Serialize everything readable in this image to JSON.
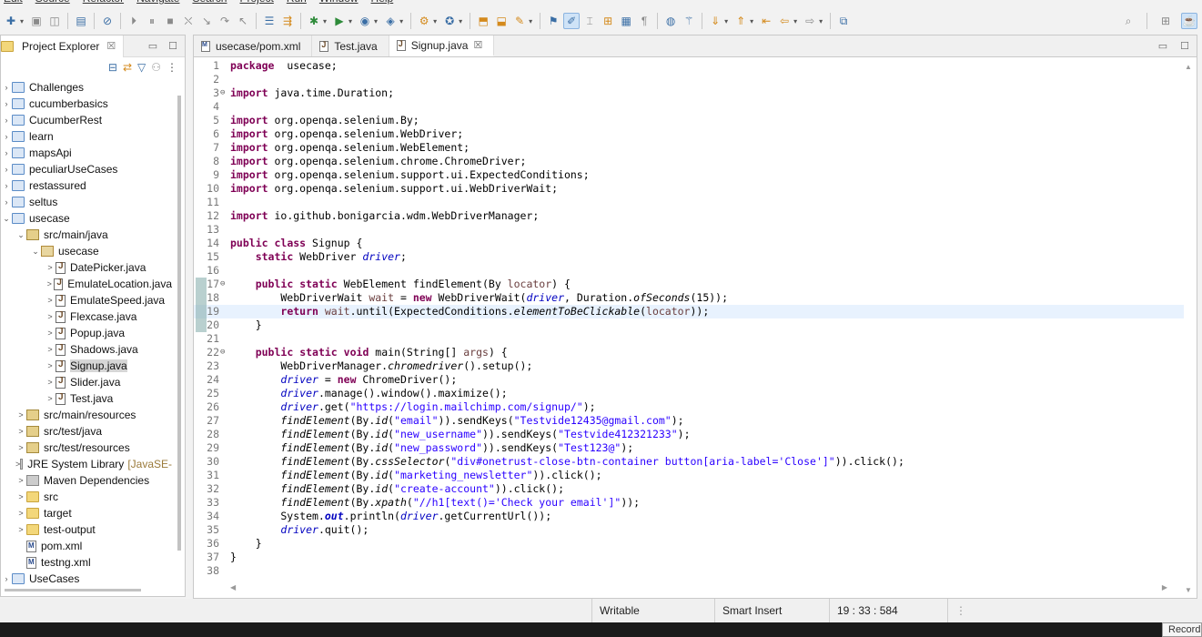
{
  "menu": [
    "Edit",
    "Source",
    "Refactor",
    "Navigate",
    "Search",
    "Project",
    "Run",
    "Window",
    "Help"
  ],
  "explorer": {
    "title": "Project Explorer",
    "close": "☒",
    "tree": [
      {
        "label": "Challenges",
        "depth": 0,
        "twisty": "›",
        "icon": "project"
      },
      {
        "label": "cucumberbasics",
        "depth": 0,
        "twisty": "›",
        "icon": "project"
      },
      {
        "label": "CucumberRest",
        "depth": 0,
        "twisty": "›",
        "icon": "project"
      },
      {
        "label": "learn",
        "depth": 0,
        "twisty": "›",
        "icon": "maven-project"
      },
      {
        "label": "mapsApi",
        "depth": 0,
        "twisty": "›",
        "icon": "project"
      },
      {
        "label": "peculiarUseCases",
        "depth": 0,
        "twisty": "›",
        "icon": "project"
      },
      {
        "label": "restassured",
        "depth": 0,
        "twisty": "›",
        "icon": "project"
      },
      {
        "label": "seltus",
        "depth": 0,
        "twisty": "›",
        "icon": "project"
      },
      {
        "label": "usecase",
        "depth": 0,
        "twisty": "⌄",
        "icon": "maven-project"
      },
      {
        "label": "src/main/java",
        "depth": 1,
        "twisty": "⌄",
        "icon": "src-folder"
      },
      {
        "label": "usecase",
        "depth": 2,
        "twisty": "⌄",
        "icon": "package"
      },
      {
        "label": "DatePicker.java",
        "depth": 3,
        "twisty": ">",
        "icon": "java"
      },
      {
        "label": "EmulateLocation.java",
        "depth": 3,
        "twisty": ">",
        "icon": "java"
      },
      {
        "label": "EmulateSpeed.java",
        "depth": 3,
        "twisty": ">",
        "icon": "java"
      },
      {
        "label": "Flexcase.java",
        "depth": 3,
        "twisty": ">",
        "icon": "java"
      },
      {
        "label": "Popup.java",
        "depth": 3,
        "twisty": ">",
        "icon": "java"
      },
      {
        "label": "Shadows.java",
        "depth": 3,
        "twisty": ">",
        "icon": "java"
      },
      {
        "label": "Signup.java",
        "depth": 3,
        "twisty": ">",
        "icon": "java",
        "selected": true
      },
      {
        "label": "Slider.java",
        "depth": 3,
        "twisty": ">",
        "icon": "java"
      },
      {
        "label": "Test.java",
        "depth": 3,
        "twisty": ">",
        "icon": "java"
      },
      {
        "label": "src/main/resources",
        "depth": 1,
        "twisty": ">",
        "icon": "src-folder"
      },
      {
        "label": "src/test/java",
        "depth": 1,
        "twisty": ">",
        "icon": "src-folder"
      },
      {
        "label": "src/test/resources",
        "depth": 1,
        "twisty": ">",
        "icon": "src-folder"
      },
      {
        "label": "JRE System Library",
        "decoration": "[JavaSE-",
        "depth": 1,
        "twisty": ">",
        "icon": "library"
      },
      {
        "label": "Maven Dependencies",
        "depth": 1,
        "twisty": ">",
        "icon": "library"
      },
      {
        "label": "src",
        "depth": 1,
        "twisty": ">",
        "icon": "folder"
      },
      {
        "label": "target",
        "depth": 1,
        "twisty": ">",
        "icon": "folder"
      },
      {
        "label": "test-output",
        "depth": 1,
        "twisty": ">",
        "icon": "folder"
      },
      {
        "label": "pom.xml",
        "depth": 1,
        "twisty": "",
        "icon": "xml"
      },
      {
        "label": "testng.xml",
        "depth": 1,
        "twisty": "",
        "icon": "xml"
      },
      {
        "label": "UseCases",
        "depth": 0,
        "twisty": "›",
        "icon": "project"
      }
    ]
  },
  "editor": {
    "tabs": [
      {
        "label": "usecase/pom.xml",
        "type": "m",
        "active": false
      },
      {
        "label": "Test.java",
        "type": "j",
        "active": false
      },
      {
        "label": "Signup.java",
        "type": "j",
        "active": true,
        "close": "☒"
      }
    ],
    "current_line": 19,
    "changed_lines": [
      17,
      18,
      19,
      20
    ],
    "fold_lines": [
      3,
      17,
      22
    ],
    "lines": [
      [
        [
          "kw",
          "package"
        ],
        [
          "",
          "  usecase;"
        ]
      ],
      [],
      [
        [
          "kw",
          "import"
        ],
        [
          "",
          " java.time.Duration;"
        ]
      ],
      [],
      [
        [
          "kw",
          "import"
        ],
        [
          "",
          " org.openqa.selenium.By;"
        ]
      ],
      [
        [
          "kw",
          "import"
        ],
        [
          "",
          " org.openqa.selenium.WebDriver;"
        ]
      ],
      [
        [
          "kw",
          "import"
        ],
        [
          "",
          " org.openqa.selenium.WebElement;"
        ]
      ],
      [
        [
          "kw",
          "import"
        ],
        [
          "",
          " org.openqa.selenium.chrome.ChromeDriver;"
        ]
      ],
      [
        [
          "kw",
          "import"
        ],
        [
          "",
          " org.openqa.selenium.support.ui.ExpectedConditions;"
        ]
      ],
      [
        [
          "kw",
          "import"
        ],
        [
          "",
          " org.openqa.selenium.support.ui.WebDriverWait;"
        ]
      ],
      [],
      [
        [
          "kw",
          "import"
        ],
        [
          "",
          " io.github.bonigarcia.wdm.WebDriverManager;"
        ]
      ],
      [],
      [
        [
          "kw",
          "public"
        ],
        [
          "",
          " "
        ],
        [
          "kw",
          "class"
        ],
        [
          "",
          " Signup {"
        ]
      ],
      [
        [
          "",
          "    "
        ],
        [
          "kw",
          "static"
        ],
        [
          "",
          " WebDriver "
        ],
        [
          "fld",
          "driver"
        ],
        [
          "",
          ";"
        ]
      ],
      [],
      [
        [
          "",
          "    "
        ],
        [
          "kw",
          "public"
        ],
        [
          "",
          " "
        ],
        [
          "kw",
          "static"
        ],
        [
          "",
          " WebElement findElement(By "
        ],
        [
          "param",
          "locator"
        ],
        [
          "",
          ") {"
        ]
      ],
      [
        [
          "",
          "        WebDriverWait "
        ],
        [
          "lvar",
          "wait"
        ],
        [
          "",
          " = "
        ],
        [
          "kw",
          "new"
        ],
        [
          "",
          " WebDriverWait("
        ],
        [
          "fld",
          "driver"
        ],
        [
          "",
          ", Duration."
        ],
        [
          "smeth",
          "ofSeconds"
        ],
        [
          "",
          "(15));"
        ]
      ],
      [
        [
          "",
          "        "
        ],
        [
          "kw",
          "return"
        ],
        [
          "",
          " "
        ],
        [
          "lvar",
          "wait"
        ],
        [
          "",
          ".until(ExpectedConditions."
        ],
        [
          "smeth",
          "elementToBeClickable"
        ],
        [
          "",
          "("
        ],
        [
          "param",
          "locator"
        ],
        [
          "",
          "));"
        ]
      ],
      [
        [
          "",
          "    }"
        ]
      ],
      [],
      [
        [
          "",
          "    "
        ],
        [
          "kw",
          "public"
        ],
        [
          "",
          " "
        ],
        [
          "kw",
          "static"
        ],
        [
          "",
          " "
        ],
        [
          "kw",
          "void"
        ],
        [
          "",
          " main(String[] "
        ],
        [
          "param",
          "args"
        ],
        [
          "",
          ") {"
        ]
      ],
      [
        [
          "",
          "        WebDriverManager."
        ],
        [
          "smeth",
          "chromedriver"
        ],
        [
          "",
          "().setup();"
        ]
      ],
      [
        [
          "",
          "        "
        ],
        [
          "fld",
          "driver"
        ],
        [
          "",
          " = "
        ],
        [
          "kw",
          "new"
        ],
        [
          "",
          " ChromeDriver();"
        ]
      ],
      [
        [
          "",
          "        "
        ],
        [
          "fld",
          "driver"
        ],
        [
          "",
          ".manage().window().maximize();"
        ]
      ],
      [
        [
          "",
          "        "
        ],
        [
          "fld",
          "driver"
        ],
        [
          "",
          ".get("
        ],
        [
          "str",
          "\"https://login.mailchimp.com/signup/\""
        ],
        [
          "",
          ");"
        ]
      ],
      [
        [
          "",
          "        "
        ],
        [
          "smeth",
          "findElement"
        ],
        [
          "",
          "(By."
        ],
        [
          "smeth",
          "id"
        ],
        [
          "",
          "("
        ],
        [
          "str",
          "\"email\""
        ],
        [
          "",
          "))."
        ],
        [
          "",
          "sendKeys("
        ],
        [
          "str",
          "\"Testvide12435@gmail.com\""
        ],
        [
          "",
          ");"
        ]
      ],
      [
        [
          "",
          "        "
        ],
        [
          "smeth",
          "findElement"
        ],
        [
          "",
          "(By."
        ],
        [
          "smeth",
          "id"
        ],
        [
          "",
          "("
        ],
        [
          "str",
          "\"new_username\""
        ],
        [
          "",
          "))."
        ],
        [
          "",
          "sendKeys("
        ],
        [
          "str",
          "\"Testvide412321233\""
        ],
        [
          "",
          ");"
        ]
      ],
      [
        [
          "",
          "        "
        ],
        [
          "smeth",
          "findElement"
        ],
        [
          "",
          "(By."
        ],
        [
          "smeth",
          "id"
        ],
        [
          "",
          "("
        ],
        [
          "str",
          "\"new_password\""
        ],
        [
          "",
          "))."
        ],
        [
          "",
          "sendKeys("
        ],
        [
          "str",
          "\"Test123@\""
        ],
        [
          "",
          ");"
        ]
      ],
      [
        [
          "",
          "        "
        ],
        [
          "smeth",
          "findElement"
        ],
        [
          "",
          "(By."
        ],
        [
          "smeth",
          "cssSelector"
        ],
        [
          "",
          "("
        ],
        [
          "str",
          "\"div#onetrust-close-btn-container button[aria-label='Close']\""
        ],
        [
          "",
          ")).click();"
        ]
      ],
      [
        [
          "",
          "        "
        ],
        [
          "smeth",
          "findElement"
        ],
        [
          "",
          "(By."
        ],
        [
          "smeth",
          "id"
        ],
        [
          "",
          "("
        ],
        [
          "str",
          "\"marketing_newsletter\""
        ],
        [
          "",
          ")).click();"
        ]
      ],
      [
        [
          "",
          "        "
        ],
        [
          "smeth",
          "findElement"
        ],
        [
          "",
          "(By."
        ],
        [
          "smeth",
          "id"
        ],
        [
          "",
          "("
        ],
        [
          "str",
          "\"create-account\""
        ],
        [
          "",
          ")).click();"
        ]
      ],
      [
        [
          "",
          "        "
        ],
        [
          "smeth",
          "findElement"
        ],
        [
          "",
          "(By."
        ],
        [
          "smeth",
          "xpath"
        ],
        [
          "",
          "("
        ],
        [
          "str",
          "\"//h1[text()='Check your email']\""
        ],
        [
          "",
          "));"
        ]
      ],
      [
        [
          "",
          "        System."
        ],
        [
          "sfld",
          "out"
        ],
        [
          "",
          ".println("
        ],
        [
          "fld",
          "driver"
        ],
        [
          "",
          ".getCurrentUrl());"
        ]
      ],
      [
        [
          "",
          "        "
        ],
        [
          "fld",
          "driver"
        ],
        [
          "",
          ".quit();"
        ]
      ],
      [
        [
          "",
          "    }"
        ]
      ],
      [
        [
          "",
          "}"
        ]
      ],
      []
    ]
  },
  "status": {
    "writable": "Writable",
    "insert_mode": "Smart Insert",
    "position": "19 : 33 : 584"
  },
  "taskbar": {
    "record": "Record"
  }
}
